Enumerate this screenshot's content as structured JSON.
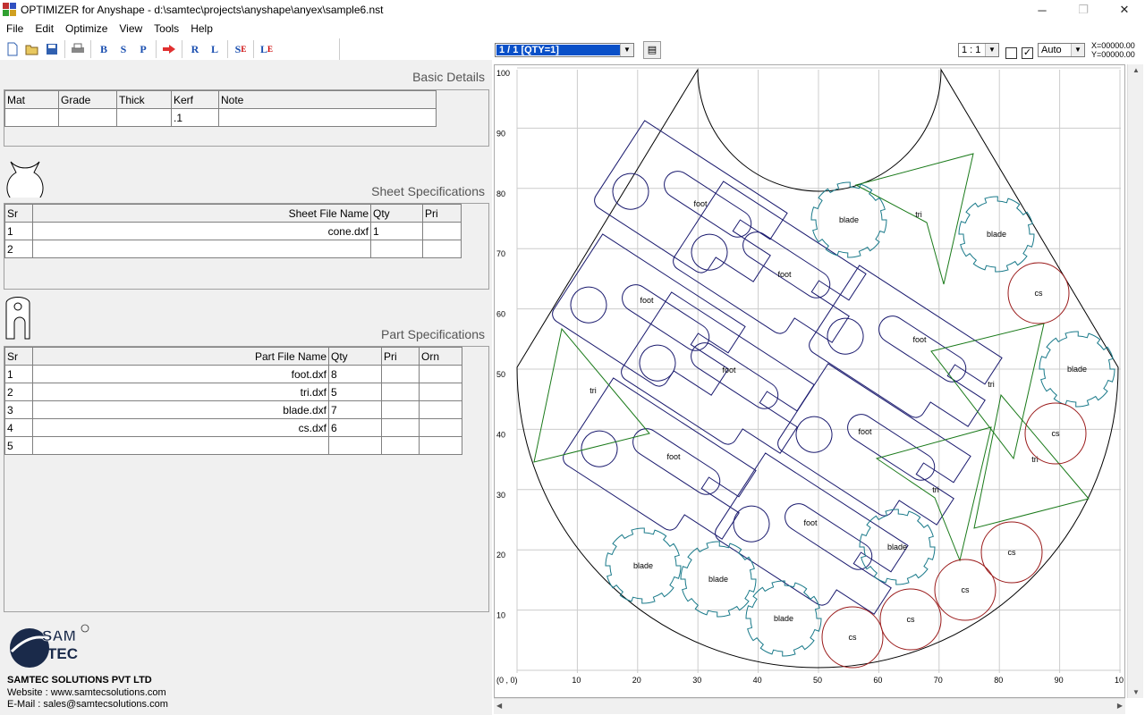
{
  "window": {
    "title": "OPTIMIZER for Anyshape - d:\\samtec\\projects\\anyshape\\anyex\\sample6.nst",
    "minimize": "─",
    "maximize": "❐",
    "close": "✕"
  },
  "menu": [
    "File",
    "Edit",
    "Optimize",
    "View",
    "Tools",
    "Help"
  ],
  "toolbar": {
    "buttons": [
      "new-icon",
      "open-icon",
      "save-icon",
      "print-icon",
      "B",
      "S",
      "P",
      "run-icon",
      "R",
      "L",
      "S",
      "E",
      "L",
      "E"
    ]
  },
  "basic_details": {
    "title": "Basic Details",
    "columns": [
      "Mat",
      "Grade",
      "Thick",
      "Kerf",
      "Note"
    ],
    "row": [
      "",
      "",
      "",
      ".1",
      ""
    ]
  },
  "sheet_specs": {
    "title": "Sheet Specifications",
    "columns": [
      "Sr",
      "Sheet File Name",
      "Qty",
      "Pri"
    ],
    "rows": [
      [
        "1",
        "cone.dxf",
        "1",
        ""
      ],
      [
        "2",
        "",
        "",
        ""
      ]
    ]
  },
  "part_specs": {
    "title": "Part Specifications",
    "columns": [
      "Sr",
      "Part File Name",
      "Qty",
      "Pri",
      "Orn"
    ],
    "rows": [
      [
        "1",
        "foot.dxf",
        "8",
        "",
        ""
      ],
      [
        "2",
        "tri.dxf",
        "5",
        "",
        ""
      ],
      [
        "3",
        "blade.dxf",
        "7",
        "",
        ""
      ],
      [
        "4",
        "cs.dxf",
        "6",
        "",
        ""
      ],
      [
        "5",
        "",
        "",
        "",
        ""
      ]
    ]
  },
  "company": {
    "logo_text_1": "SAM",
    "logo_text_2": "TEC",
    "name": "SAMTEC SOLUTIONS PVT LTD",
    "website": "Website : www.samtecsolutions.com",
    "email": "E-Mail : sales@samtecsolutions.com"
  },
  "viewer": {
    "layout_selected": "1 / 1   [QTY=1]",
    "zoom": "1 : 1",
    "checkbox1": false,
    "checkbox2": true,
    "auto": "Auto",
    "coord_x": "X=00000.00",
    "coord_y": "Y=00000.00",
    "origin_label": "(0 , 0)",
    "x_ticks": [
      "10",
      "20",
      "30",
      "40",
      "50",
      "60",
      "70",
      "80",
      "90",
      "10"
    ],
    "y_ticks": [
      "100",
      "90",
      "80",
      "70",
      "60",
      "50",
      "40",
      "30",
      "20",
      "10"
    ]
  },
  "nest_parts": {
    "colors": {
      "sheet": "#000000",
      "foot": "#1a1a6e",
      "tri": "#1a7a1a",
      "blade": "#1a7a8a",
      "cs": "#9a1a1a",
      "grid": "#cccccc"
    },
    "foot_labels": [
      "foot",
      "foot",
      "foot",
      "foot",
      "foot",
      "foot",
      "foot",
      "foot"
    ],
    "tri_labels": [
      "tri",
      "tri",
      "tri",
      "tri",
      "tri"
    ],
    "blade_labels": [
      "blade",
      "blade",
      "blade",
      "blade",
      "blade",
      "blade",
      "blade"
    ],
    "cs_labels": [
      "cs",
      "cs",
      "cs",
      "cs",
      "cs",
      "cs"
    ]
  }
}
